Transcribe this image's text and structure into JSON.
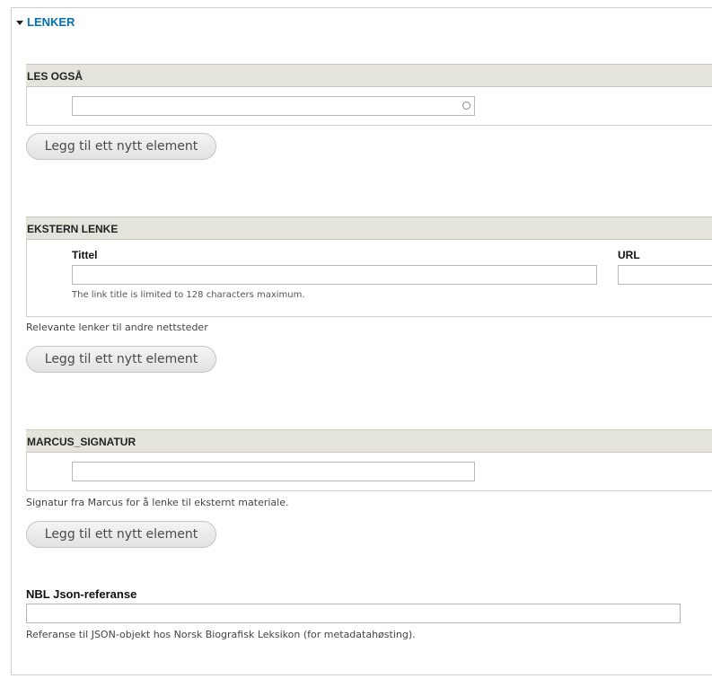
{
  "section": {
    "legend": "LENKER"
  },
  "les_ogsa": {
    "title": "LES OGSÅ",
    "input_value": "",
    "add_button": "Legg til ett nytt element"
  },
  "ekstern_lenke": {
    "title": "EKSTERN LENKE",
    "tittel_label": "Tittel",
    "url_label": "URL",
    "tittel_value": "",
    "url_value": "",
    "tittel_help": "The link title is limited to 128 characters maximum.",
    "description": "Relevante lenker til andre nettsteder",
    "add_button": "Legg til ett nytt element"
  },
  "marcus_signatur": {
    "title": "MARCUS_SIGNATUR",
    "input_value": "",
    "description": "Signatur fra Marcus for å lenke til eksternt materiale.",
    "add_button": "Legg til ett nytt element"
  },
  "nbl_json": {
    "label": "NBL Json-referanse",
    "input_value": "",
    "description": "Referanse til JSON-objekt hos Norsk Biografisk Leksikon (for metadatahøsting)."
  }
}
